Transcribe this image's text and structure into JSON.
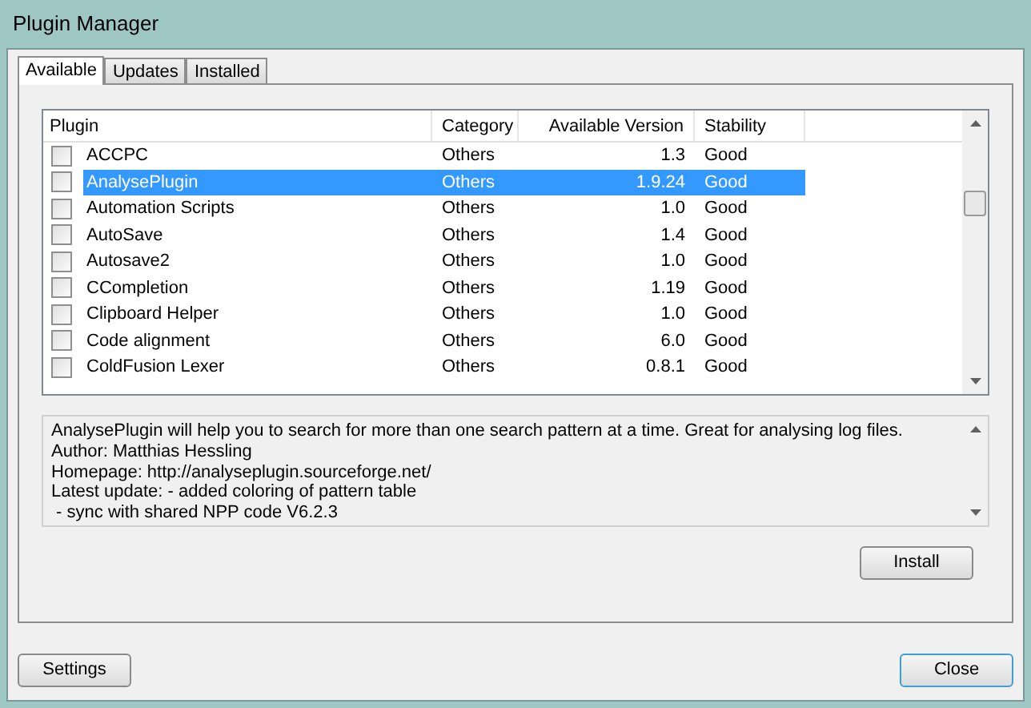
{
  "window": {
    "title": "Plugin Manager"
  },
  "tabs": [
    {
      "label": "Available",
      "selected": true
    },
    {
      "label": "Updates",
      "selected": false
    },
    {
      "label": "Installed",
      "selected": false
    }
  ],
  "table": {
    "columns": [
      "Plugin",
      "Category",
      "Available Version",
      "Stability"
    ],
    "rows": [
      {
        "name": "ACCPC",
        "category": "Others",
        "version": "1.3",
        "stability": "Good",
        "checked": false,
        "selected": false
      },
      {
        "name": "AnalysePlugin",
        "category": "Others",
        "version": "1.9.24",
        "stability": "Good",
        "checked": false,
        "selected": true
      },
      {
        "name": "Automation Scripts",
        "category": "Others",
        "version": "1.0",
        "stability": "Good",
        "checked": false,
        "selected": false
      },
      {
        "name": "AutoSave",
        "category": "Others",
        "version": "1.4",
        "stability": "Good",
        "checked": false,
        "selected": false
      },
      {
        "name": "Autosave2",
        "category": "Others",
        "version": "1.0",
        "stability": "Good",
        "checked": false,
        "selected": false
      },
      {
        "name": "CCompletion",
        "category": "Others",
        "version": "1.19",
        "stability": "Good",
        "checked": false,
        "selected": false
      },
      {
        "name": "Clipboard Helper",
        "category": "Others",
        "version": "1.0",
        "stability": "Good",
        "checked": false,
        "selected": false
      },
      {
        "name": "Code alignment",
        "category": "Others",
        "version": "6.0",
        "stability": "Good",
        "checked": false,
        "selected": false
      },
      {
        "name": "ColdFusion Lexer",
        "category": "Others",
        "version": "0.8.1",
        "stability": "Good",
        "checked": false,
        "selected": false
      }
    ]
  },
  "description": [
    "AnalysePlugin will help you to search for more than one search pattern at a time. Great for analysing log files.",
    "Author: Matthias Hessling",
    "Homepage: http://analyseplugin.sourceforge.net/",
    "Latest update: - added coloring of pattern table",
    " - sync with shared NPP code V6.2.3"
  ],
  "buttons": {
    "install": "Install",
    "settings": "Settings",
    "close": "Close"
  }
}
